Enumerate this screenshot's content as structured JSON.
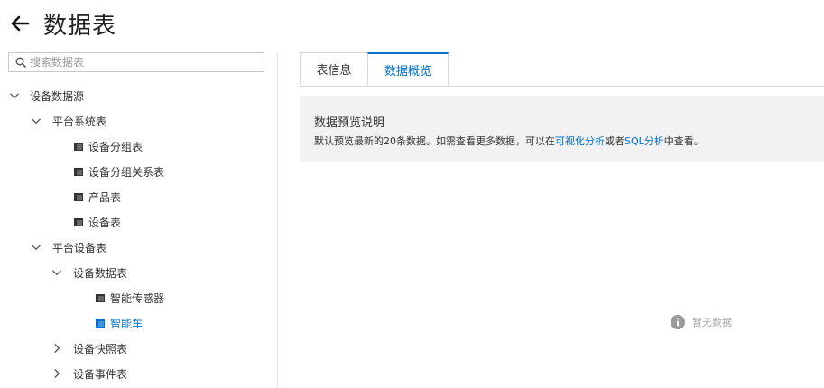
{
  "header": {
    "title": "数据表",
    "back_icon": "arrow-left-icon"
  },
  "search": {
    "placeholder": "搜索数据表",
    "value": ""
  },
  "tree": {
    "device_source": "设备数据源",
    "platform_system": "平台系统表",
    "device_group": "设备分组表",
    "device_group_rel": "设备分组关系表",
    "product": "产品表",
    "device": "设备表",
    "platform_device": "平台设备表",
    "device_data": "设备数据表",
    "smart_sensor": "智能传感器",
    "smart_car": "智能车",
    "device_snapshot": "设备快照表",
    "device_event": "设备事件表"
  },
  "tabs": [
    {
      "label": "表信息",
      "active": false
    },
    {
      "label": "数据概览",
      "active": true
    }
  ],
  "notice": {
    "title": "数据预览说明",
    "text_before": "默认预览最新的20条数据。如需查看更多数据，可以在",
    "link1": "可视化分析",
    "text_middle": "或者",
    "link2": "SQL分析",
    "text_after": "中查看。"
  },
  "empty": {
    "text": "暂无数据",
    "icon": "info-icon"
  },
  "colors": {
    "accent": "#0070cc",
    "notice_bg": "#f2f2f2",
    "border": "#d9d9d9"
  }
}
